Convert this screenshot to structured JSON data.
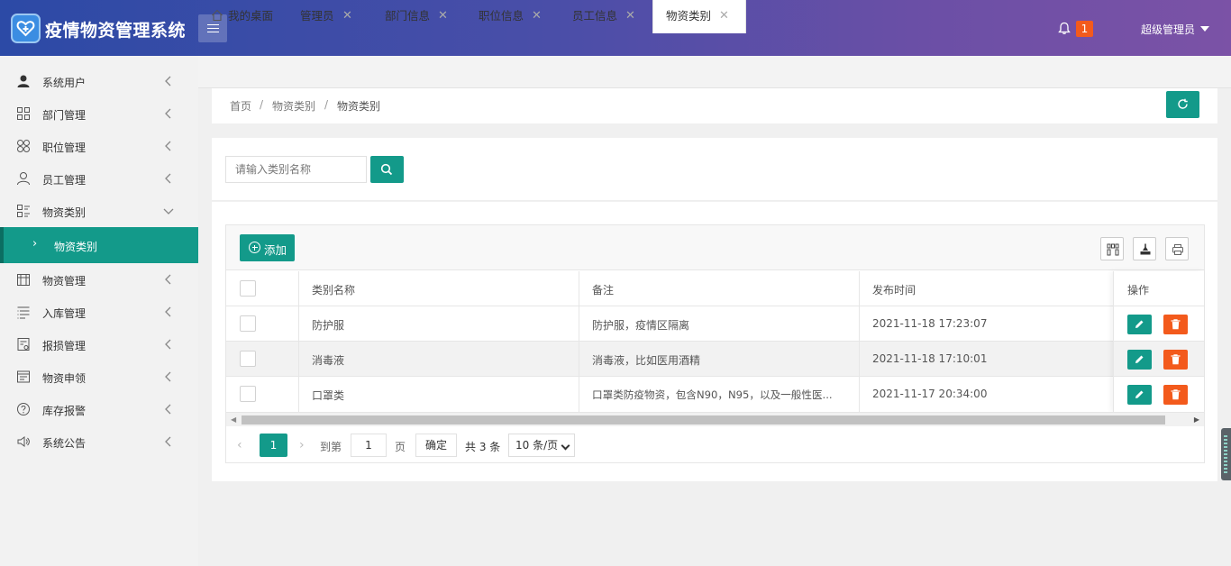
{
  "header": {
    "title": "疫情物资管理系统",
    "notification_count": "1",
    "user_name": "超级管理员"
  },
  "sidebar": {
    "items": [
      {
        "label": "系统用户",
        "icon": "user-icon"
      },
      {
        "label": "部门管理",
        "icon": "grid-icon"
      },
      {
        "label": "职位管理",
        "icon": "clover-icon"
      },
      {
        "label": "员工管理",
        "icon": "person-icon"
      },
      {
        "label": "物资类别",
        "icon": "category-icon",
        "expanded": true
      },
      {
        "label": "物资管理",
        "icon": "calendar-icon"
      },
      {
        "label": "入库管理",
        "icon": "list-icon"
      },
      {
        "label": "报损管理",
        "icon": "form-icon"
      },
      {
        "label": "物资申领",
        "icon": "window-icon"
      },
      {
        "label": "库存报警",
        "icon": "help-icon"
      },
      {
        "label": "系统公告",
        "icon": "speaker-icon"
      }
    ],
    "sub_item": "物资类别"
  },
  "tabs": [
    {
      "label": "我的桌面",
      "closable": false
    },
    {
      "label": "管理员",
      "closable": true
    },
    {
      "label": "部门信息",
      "closable": true
    },
    {
      "label": "职位信息",
      "closable": true
    },
    {
      "label": "员工信息",
      "closable": true
    },
    {
      "label": "物资类别",
      "closable": true,
      "active": true
    }
  ],
  "breadcrumb": {
    "items": [
      "首页",
      "物资类别",
      "物资类别"
    ],
    "separator": "/"
  },
  "search": {
    "placeholder": "请输入类别名称"
  },
  "toolbar": {
    "add_label": "添加"
  },
  "table": {
    "columns": [
      "类别名称",
      "备注",
      "发布时间",
      "操作"
    ],
    "rows": [
      {
        "name": "防护服",
        "note": "防护服，疫情区隔离",
        "time": "2021-11-18 17:23:07"
      },
      {
        "name": "消毒液",
        "note": "消毒液，比如医用酒精",
        "time": "2021-11-18 17:10:01"
      },
      {
        "name": "口罩类",
        "note": "口罩类防疫物资，包含N90，N95，以及一般性医...",
        "time": "2021-11-17 20:34:00"
      }
    ]
  },
  "pager": {
    "current_page": "1",
    "goto_label": "到第",
    "goto_value": "1",
    "page_unit": "页",
    "confirm_label": "确定",
    "total_label": "共 3 条",
    "page_size": "10 条/页"
  },
  "colors": {
    "primary": "#139a8a",
    "danger": "#f35a1c",
    "header_gradient_start": "#2c4aa6",
    "header_gradient_end": "#7b52a6"
  }
}
